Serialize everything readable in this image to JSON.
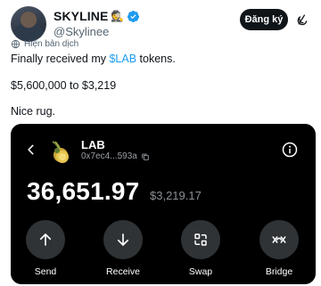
{
  "author": {
    "display_name": "SKYLINE",
    "name_emoji": "🕵️",
    "handle": "@Skylinee",
    "follow_label": "Đăng ký"
  },
  "tweet": {
    "translate_label": "Hiện bản dịch",
    "line1_prefix": "Finally received my ",
    "line1_cashtag": "$LAB",
    "line1_suffix": " tokens.",
    "line2": "$5,600,000 to $3,219",
    "line3": "Nice rug."
  },
  "wallet": {
    "token_name": "LAB",
    "token_address": "0x7ec4...593a",
    "balance": "36,651.97",
    "usd_value": "$3,219.17",
    "actions": [
      "Send",
      "Receive",
      "Swap",
      "Bridge"
    ]
  },
  "colors": {
    "link": "#1d9bf0",
    "verified": "#1d9bf0",
    "card_bg": "#000000",
    "button_circle": "#2f3336"
  }
}
